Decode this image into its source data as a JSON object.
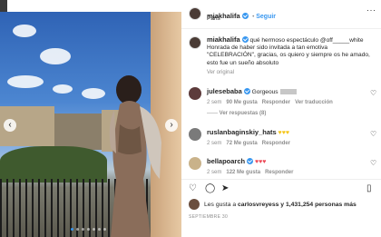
{
  "post": {
    "username": "miakhalifa",
    "follow_label": "Seguir",
    "location": "Paris",
    "more_icon": "more-horizontal-icon"
  },
  "caption": {
    "username": "miakhalifa",
    "text": "qué hermoso espectáculo @off_____white Honrada de haber sido invitada a tan emotiva \"CELEBRACIÓN\", gracias, os quiero y siempre os he amado, esto fue un sueño absoluto",
    "see_translation": "Ver original"
  },
  "comments": [
    {
      "username": "julesebaba",
      "text": "Gorgeous",
      "time": "2 sem",
      "likes": "90 Me gusta",
      "reply": "Responder",
      "translate": "Ver traducción",
      "replies": "Ver respuestas (8)"
    },
    {
      "username": "ruslanbaginskiy_hats",
      "text": "",
      "time": "2 sem",
      "likes": "72 Me gusta",
      "reply": "Responder"
    },
    {
      "username": "bellapoarch",
      "text": "",
      "time": "2 sem",
      "likes": "122 Me gusta",
      "reply": "Responder"
    }
  ],
  "likes_line": {
    "prefix": "Les gusta a ",
    "user": "carlosvreyess",
    "suffix": " y 1,431,254 personas más"
  },
  "date": "SEPTIEMBRE 30",
  "colors": {
    "accent": "#3897f0",
    "text": "#262626",
    "muted": "#8e8e8e",
    "heart": "#ed4956"
  }
}
